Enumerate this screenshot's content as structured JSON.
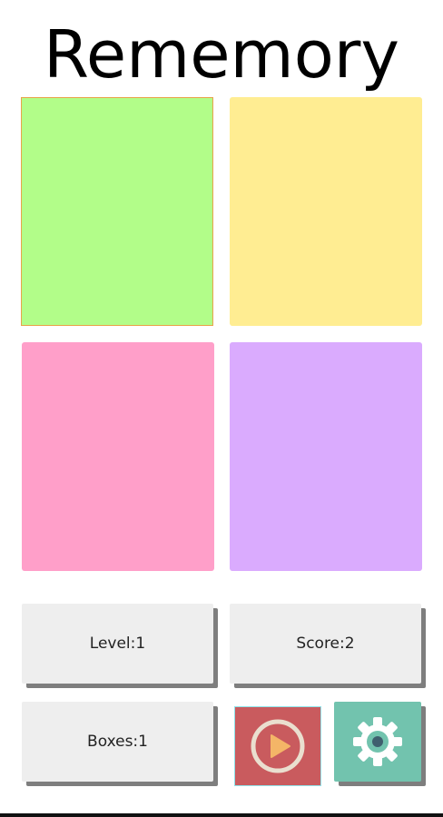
{
  "app": {
    "title": "Rememory"
  },
  "tiles": [
    {
      "name": "green",
      "color": "#b2fd89",
      "selected": true
    },
    {
      "name": "yellow",
      "color": "#ffed92"
    },
    {
      "name": "pink",
      "color": "#ff9fc9"
    },
    {
      "name": "purple",
      "color": "#daabfe"
    }
  ],
  "stats": {
    "level": "Level:1",
    "score": "Score:2",
    "boxes": "Boxes:1"
  },
  "controls": {
    "play_icon": "play-icon",
    "play_color": "#c95b5e",
    "play_accent": "#f4b567",
    "settings_icon": "gear-icon",
    "settings_color": "#72c3ae"
  }
}
